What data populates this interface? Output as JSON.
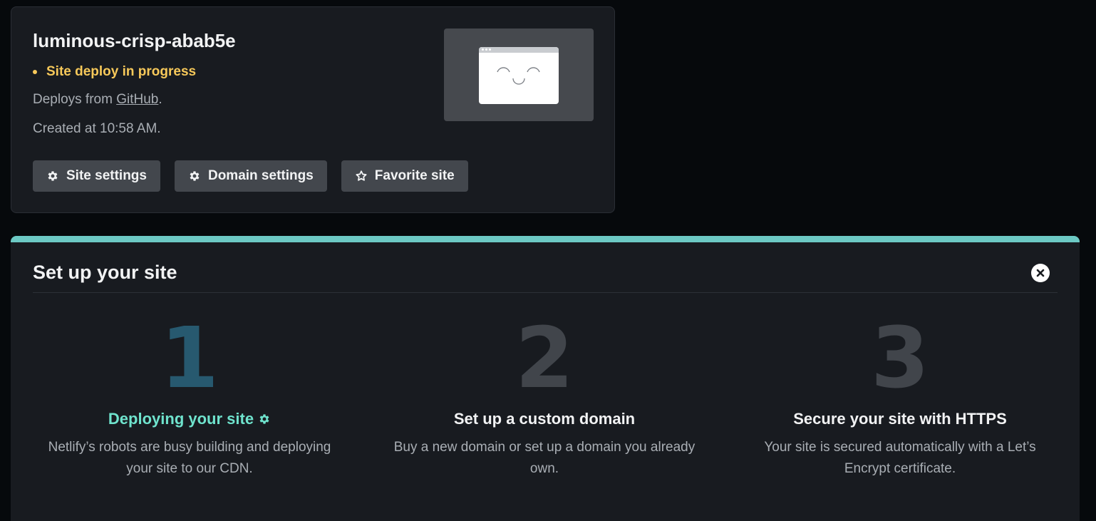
{
  "site": {
    "name": "luminous-crisp-abab5e",
    "status": "Site deploy in progress",
    "deploys_prefix": "Deploys from ",
    "deploys_source": "GitHub",
    "deploys_suffix": ".",
    "created": "Created at 10:58 AM.",
    "buttons": {
      "site_settings": "Site settings",
      "domain_settings": "Domain settings",
      "favorite": "Favorite site"
    }
  },
  "setup": {
    "title": "Set up your site",
    "steps": [
      {
        "number": "1",
        "title": "Deploying your site",
        "description": "Netlify’s robots are busy building and deploying your site to our CDN."
      },
      {
        "number": "2",
        "title": "Set up a custom domain",
        "description": "Buy a new domain or set up a domain you already own."
      },
      {
        "number": "3",
        "title": "Secure your site with HTTPS",
        "description": "Your site is secured automatically with a Let’s Encrypt certificate."
      }
    ]
  },
  "colors": {
    "page_bg": "#06090c",
    "card_bg": "#181b20",
    "status_yellow": "#f7c95a",
    "accent_teal": "#6cc9c4",
    "active_step_title": "#6fe3cd",
    "active_step_number": "#27596f"
  },
  "icons": {
    "status": "status-dot-icon",
    "settings": "gear-icon",
    "favorite": "star-icon",
    "close": "close-icon",
    "deploying": "spinner-gear-icon",
    "preview": "browser-smiley-icon"
  }
}
